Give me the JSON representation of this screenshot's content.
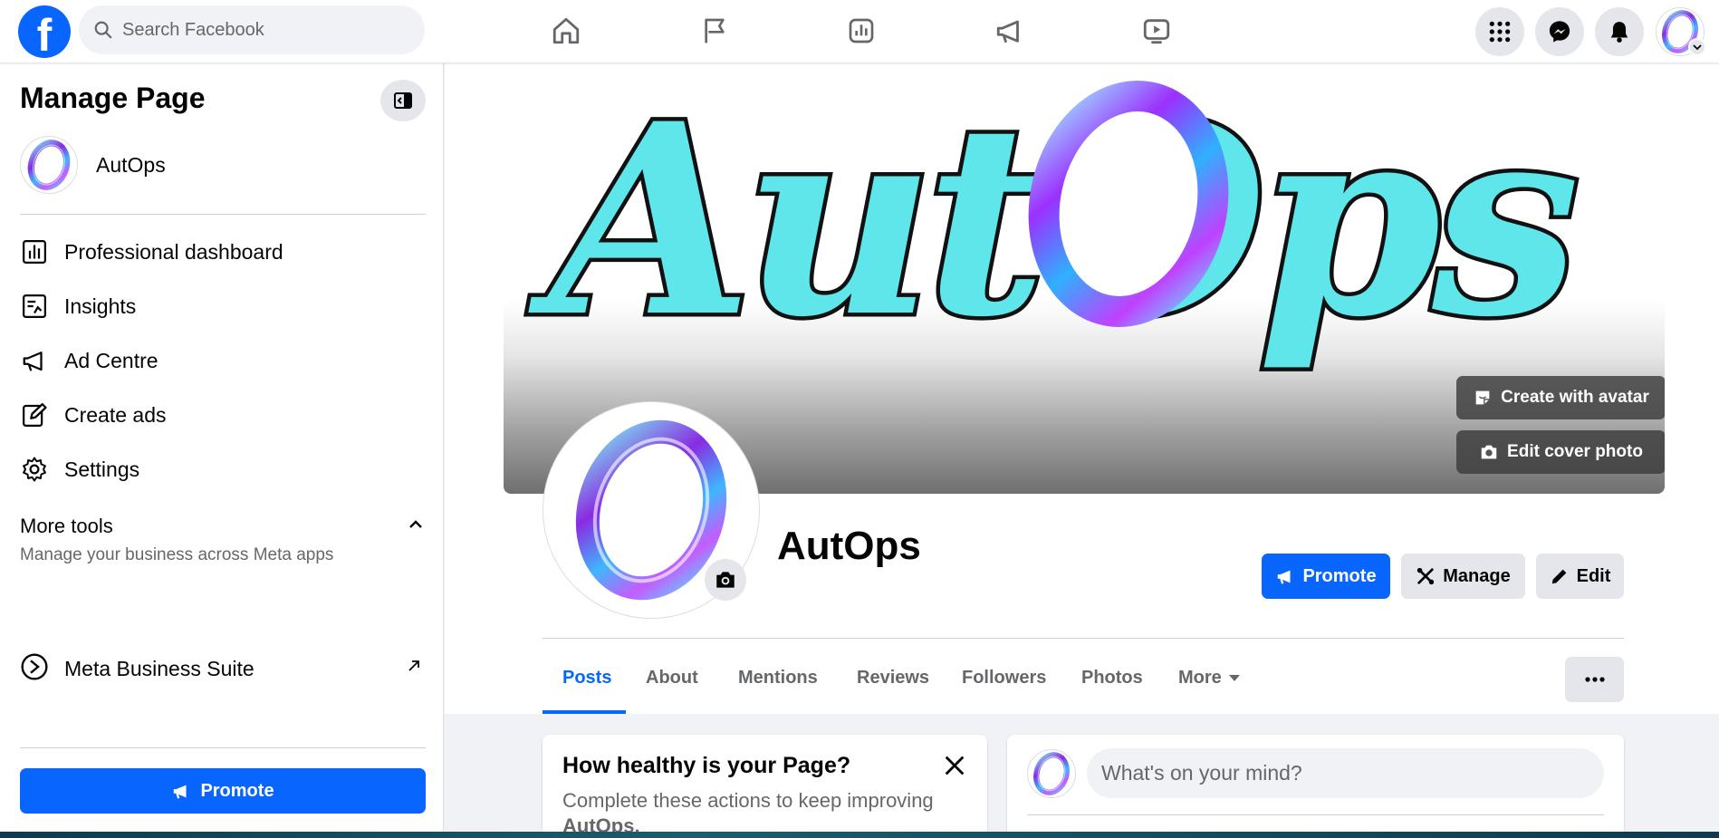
{
  "topbar": {
    "logo_letter": "f",
    "search_placeholder": "Search Facebook",
    "nav_icons": [
      "home-icon",
      "pages-flag-icon",
      "insights-chart-icon",
      "ad-centre-megaphone-icon",
      "video-icon"
    ],
    "right_icons": [
      "menu-grid-icon",
      "messenger-icon",
      "notifications-bell-icon"
    ]
  },
  "sidebar": {
    "title": "Manage Page",
    "page_name": "AutOps",
    "items": [
      {
        "label": "Professional dashboard",
        "icon": "dashboard-icon"
      },
      {
        "label": "Insights",
        "icon": "insights-icon"
      },
      {
        "label": "Ad Centre",
        "icon": "megaphone-icon"
      },
      {
        "label": "Create ads",
        "icon": "edit-ad-icon"
      },
      {
        "label": "Settings",
        "icon": "gear-icon"
      }
    ],
    "more_tools": {
      "title": "More tools",
      "subtitle": "Manage your business across Meta apps"
    },
    "meta_suite": {
      "label": "Meta Business Suite"
    },
    "promote_label": "Promote"
  },
  "cover": {
    "logo_text": "AutOps",
    "create_avatar_label": "Create with avatar",
    "edit_cover_label": "Edit cover photo"
  },
  "profile": {
    "name": "AutOps",
    "promote_label": "Promote",
    "manage_label": "Manage",
    "edit_label": "Edit"
  },
  "tabs": [
    "Posts",
    "About",
    "Mentions",
    "Reviews",
    "Followers",
    "Photos",
    "More"
  ],
  "active_tab": "Posts",
  "health_card": {
    "title": "How healthy is your Page?",
    "text": "Complete these actions to keep improving",
    "text_page": "AutOps."
  },
  "composer": {
    "placeholder": "What's on your mind?"
  },
  "colors": {
    "accent": "#0866ff",
    "page_bg": "#f0f2f5",
    "secondary_text": "#65676b"
  }
}
